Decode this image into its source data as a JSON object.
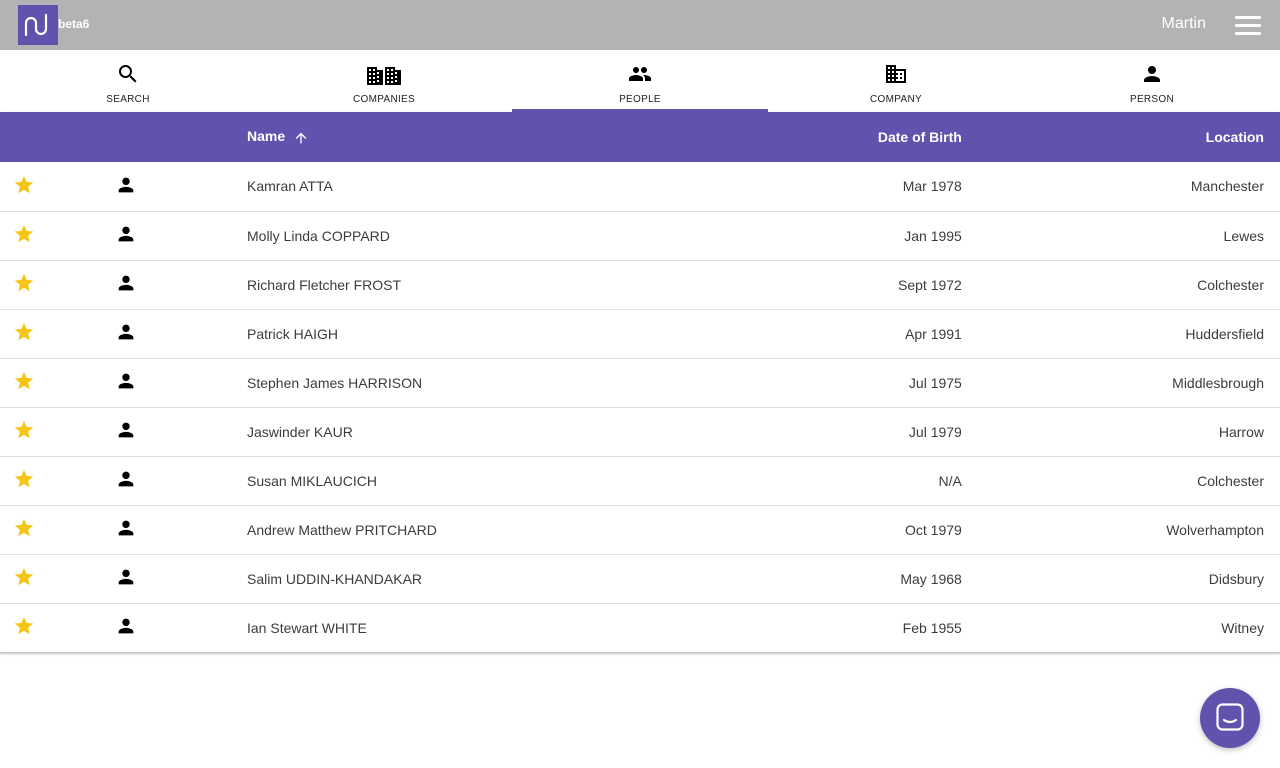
{
  "app": {
    "beta_label": "beta6",
    "user_name": "Martin",
    "accent_color": "#6252ad",
    "header_color": "#b3b3b3",
    "star_color": "#f5c518"
  },
  "tabs": [
    {
      "label": "SEARCH",
      "icon": "search-icon",
      "active": false
    },
    {
      "label": "COMPANIES",
      "icon": "companies-icon",
      "active": false
    },
    {
      "label": "PEOPLE",
      "icon": "people-icon",
      "active": true
    },
    {
      "label": "COMPANY",
      "icon": "company-icon",
      "active": false
    },
    {
      "label": "PERSON",
      "icon": "person-icon",
      "active": false
    }
  ],
  "table": {
    "columns": {
      "name": "Name",
      "dob": "Date of Birth",
      "location": "Location"
    },
    "sort": {
      "column": "name",
      "direction": "ascending"
    },
    "rows": [
      {
        "name": "Kamran ATTA",
        "dob": "Mar 1978",
        "location": "Manchester"
      },
      {
        "name": "Molly Linda COPPARD",
        "dob": "Jan 1995",
        "location": "Lewes"
      },
      {
        "name": "Richard Fletcher FROST",
        "dob": "Sept 1972",
        "location": "Colchester"
      },
      {
        "name": "Patrick HAIGH",
        "dob": "Apr 1991",
        "location": "Huddersfield"
      },
      {
        "name": "Stephen James HARRISON",
        "dob": "Jul 1975",
        "location": "Middlesbrough"
      },
      {
        "name": "Jaswinder KAUR",
        "dob": "Jul 1979",
        "location": "Harrow"
      },
      {
        "name": "Susan MIKLAUCICH",
        "dob": "N/A",
        "location": "Colchester"
      },
      {
        "name": "Andrew Matthew PRITCHARD",
        "dob": "Oct 1979",
        "location": "Wolverhampton"
      },
      {
        "name": "Salim UDDIN-KHANDAKAR",
        "dob": "May 1968",
        "location": "Didsbury"
      },
      {
        "name": "Ian Stewart WHITE",
        "dob": "Feb 1955",
        "location": "Witney"
      }
    ]
  },
  "chat_button": {
    "icon": "chat-icon"
  }
}
